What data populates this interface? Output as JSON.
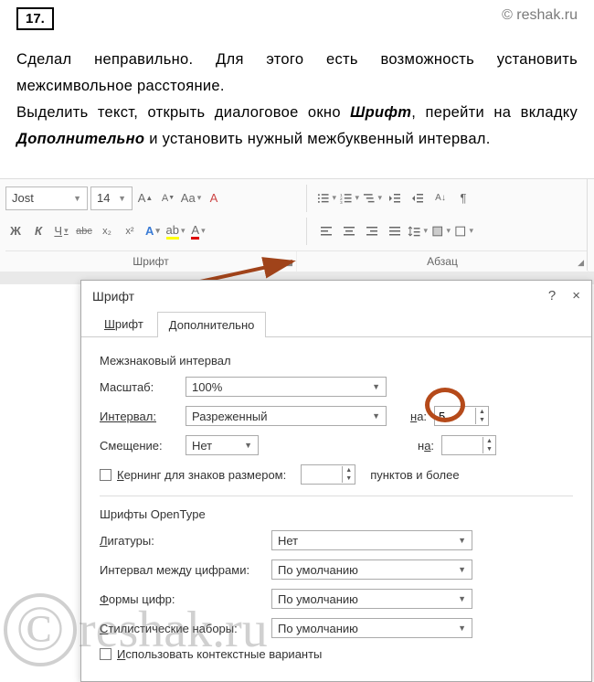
{
  "header": {
    "question_number": "17.",
    "watermark": "© reshak.ru"
  },
  "prose": {
    "p1": "Сделал неправильно. Для этого есть возможность установить межсимвольное расстояние.",
    "p2_a": "Выделить текст, открыть диалоговое окно ",
    "p2_b": "Шрифт",
    "p2_c": ", перейти на вкладку ",
    "p2_d": "Дополнительно",
    "p2_e": " и установить нужный межбуквенный интервал."
  },
  "ribbon": {
    "font_name": "Jost",
    "font_size": "14",
    "group_font": "Шрифт",
    "group_para": "Абзац",
    "bold": "Ж",
    "italic": "К",
    "underline": "Ч",
    "strike": "abc",
    "sub": "x₂",
    "sup": "x²"
  },
  "dialog": {
    "title": "Шрифт",
    "help": "?",
    "close": "×",
    "tab_font": "Шрифт",
    "tab_font_u": "Ш",
    "tab_adv": "Дополнительно",
    "tab_adv_u": "Д",
    "sec_spacing": "Межзнаковый интервал",
    "lbl_scale": "Масштаб:",
    "val_scale": "100%",
    "lbl_interval": "Интервал:",
    "val_interval": "Разреженный",
    "lbl_offset": "Смещение:",
    "val_offset": "Нет",
    "lbl_na": "на:",
    "lbl_na_u": "н",
    "val_spacing": "5",
    "chk_kerning": "Кернинг для знаков размером:",
    "chk_kerning_u": "К",
    "kerning_suffix": "пунктов и более",
    "sec_opentype": "Шрифты OpenType",
    "lbl_liga": "Лигатуры:",
    "lbl_liga_u": "Л",
    "val_none": "Нет",
    "lbl_numspacing": "Интервал между цифрами:",
    "val_default": "По умолчанию",
    "lbl_numforms": "Формы цифр:",
    "lbl_numforms_u": "Ф",
    "lbl_stylistic": "Стилистические наборы:",
    "lbl_stylistic_u": "С",
    "chk_context": "Использовать контекстные варианты",
    "chk_context_u": "И"
  },
  "watermark_big": {
    "c": "©",
    "text": "reshak.ru"
  }
}
